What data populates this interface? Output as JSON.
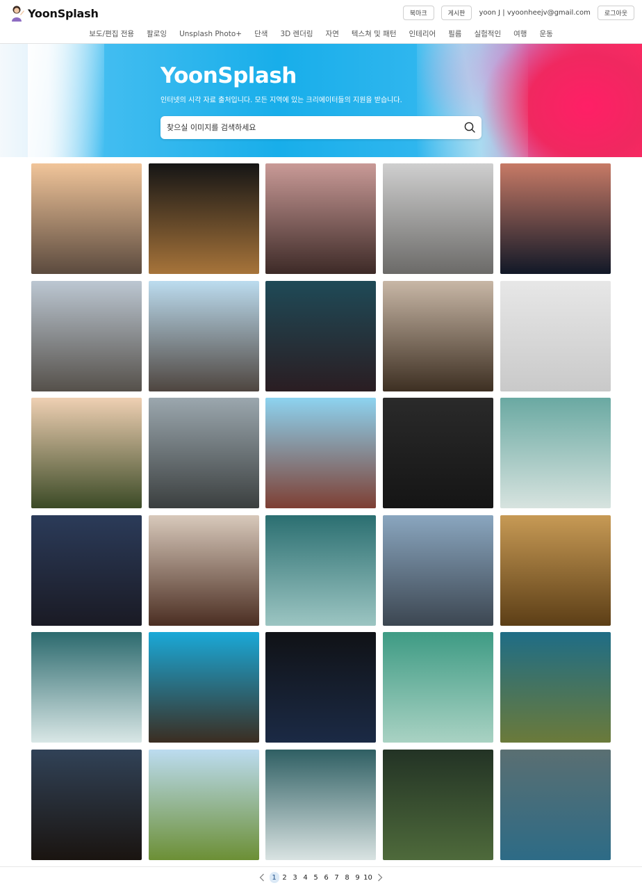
{
  "header": {
    "logo_text": "YoonSplash",
    "bookmark_label": "북마크",
    "board_label": "게시판",
    "user_label": "yoon J | vyoonheejv@gmail.com",
    "logout_label": "로그아웃"
  },
  "nav": {
    "items": [
      "보도/편집 전용",
      "팔로잉",
      "Unsplash Photo+",
      "단색",
      "3D 렌더링",
      "자연",
      "텍스쳐 및 패턴",
      "인테리어",
      "필름",
      "실험적인",
      "여행",
      "운동"
    ]
  },
  "hero": {
    "title": "YoonSplash",
    "subtitle": "인터넷의 시각 자료 출처입니다. 모든 지역에 있는 크리에이터들의 지원을 받습니다.",
    "search_placeholder": "찾으실 이미지를 검색하세요"
  },
  "photos": [
    {
      "subject": "hanok-village-sunset",
      "top": "#f1c59a",
      "bottom": "#5b4a3e"
    },
    {
      "subject": "night-alley-restaurant",
      "top": "#151515",
      "bottom": "#a7743a"
    },
    {
      "subject": "neon-street-dusk",
      "top": "#c99a97",
      "bottom": "#3d2a27"
    },
    {
      "subject": "narrow-street",
      "top": "#cfcfcf",
      "bottom": "#6b6a68"
    },
    {
      "subject": "city-night-skyline",
      "top": "#c77a66",
      "bottom": "#111827"
    },
    {
      "subject": "hanok-lane-morning",
      "top": "#bcc7d2",
      "bottom": "#55504a"
    },
    {
      "subject": "power-lines-street",
      "top": "#bcdcef",
      "bottom": "#4e453f"
    },
    {
      "subject": "shopping-street-night",
      "top": "#1f4a57",
      "bottom": "#2a1d22"
    },
    {
      "subject": "travel-shop-front",
      "top": "#c8b7a6",
      "bottom": "#3d2f22"
    },
    {
      "subject": "white-lanterns",
      "top": "#e7e7e7",
      "bottom": "#c9c9c9"
    },
    {
      "subject": "namsan-tower",
      "top": "#efd0b3",
      "bottom": "#3b4a26"
    },
    {
      "subject": "old-building-signs",
      "top": "#9ba7ae",
      "bottom": "#3b3f3f"
    },
    {
      "subject": "perforated-building",
      "top": "#8dd3f0",
      "bottom": "#7e3f33"
    },
    {
      "subject": "tunnel-black-white",
      "top": "#2a2a2a",
      "bottom": "#151515"
    },
    {
      "subject": "ocean-aerial",
      "top": "#6aa9a2",
      "bottom": "#d7e3df"
    },
    {
      "subject": "bridge-night-lights",
      "top": "#2b3b59",
      "bottom": "#1a1a24"
    },
    {
      "subject": "cafe-interior",
      "top": "#d8c9bb",
      "bottom": "#4b2e22"
    },
    {
      "subject": "waves-rocks",
      "top": "#2b6f71",
      "bottom": "#9cc5c2"
    },
    {
      "subject": "station-window-bench",
      "top": "#8aa6bf",
      "bottom": "#3c4651"
    },
    {
      "subject": "field-sunset",
      "top": "#c79a55",
      "bottom": "#5c3e16"
    },
    {
      "subject": "waves-white-foam",
      "top": "#2c6a6e",
      "bottom": "#d9e7e6"
    },
    {
      "subject": "palace-eaves-sky",
      "top": "#1aa9d8",
      "bottom": "#3b2d21"
    },
    {
      "subject": "suspension-bridge-night",
      "top": "#101216",
      "bottom": "#1b2a45"
    },
    {
      "subject": "green-sea-aerial",
      "top": "#3e9b84",
      "bottom": "#a9d2c3"
    },
    {
      "subject": "coast-waves",
      "top": "#1f6d86",
      "bottom": "#6b7a3a"
    },
    {
      "subject": "city-dusk-clouds",
      "top": "#314257",
      "bottom": "#1a1410"
    },
    {
      "subject": "green-lawn-park",
      "top": "#bcdcf0",
      "bottom": "#6c8f35"
    },
    {
      "subject": "breakwater-waves",
      "top": "#2f5f63",
      "bottom": "#d9e3e2"
    },
    {
      "subject": "cows-grass",
      "top": "#233325",
      "bottom": "#4e6a3b"
    },
    {
      "subject": "coastal-road",
      "top": "#5a6f72",
      "bottom": "#2d6b86"
    }
  ],
  "pagination": {
    "pages": [
      "1",
      "2",
      "3",
      "4",
      "5",
      "6",
      "7",
      "8",
      "9",
      "10"
    ],
    "current": "1"
  },
  "colors": {
    "accent": "#1f4f86",
    "active_page_bg": "#dbe9f6",
    "hero_blue": "#18aeea",
    "hero_pink": "#ff2a62"
  }
}
